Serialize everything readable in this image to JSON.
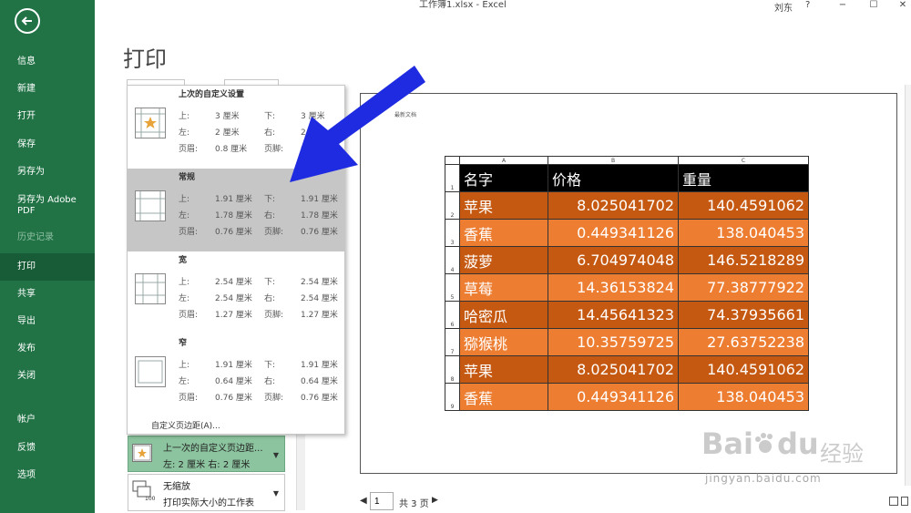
{
  "titlebar": {
    "title": "工作簿1.xlsx  -  Excel",
    "user": "刘东",
    "help": "?",
    "minimize": "−",
    "restore": "☐",
    "close": "✕"
  },
  "sidebar": {
    "items": [
      {
        "label": "信息",
        "state": "normal"
      },
      {
        "label": "新建",
        "state": "normal"
      },
      {
        "label": "打开",
        "state": "normal"
      },
      {
        "label": "保存",
        "state": "normal"
      },
      {
        "label": "另存为",
        "state": "normal"
      },
      {
        "label": "另存为 Adobe PDF",
        "state": "normal"
      },
      {
        "label": "历史记录",
        "state": "disabled"
      },
      {
        "label": "打印",
        "state": "active"
      },
      {
        "label": "共享",
        "state": "normal"
      },
      {
        "label": "导出",
        "state": "normal"
      },
      {
        "label": "发布",
        "state": "normal"
      },
      {
        "label": "关闭",
        "state": "normal"
      },
      {
        "label": "帐户",
        "state": "normal"
      },
      {
        "label": "反馈",
        "state": "normal"
      },
      {
        "label": "选项",
        "state": "normal"
      }
    ]
  },
  "page_title": "打印",
  "margins_dropdown": {
    "options": [
      {
        "name": "上次的自定义设置",
        "top_label": "上:",
        "top": "3 厘米",
        "bottom_label": "下:",
        "bottom": "3 厘米",
        "left_label": "左:",
        "left": "2 厘米",
        "right_label": "右:",
        "right": "2 厘米",
        "header_label": "页眉:",
        "header": "0.8 厘米",
        "footer_label": "页脚:",
        "footer": "0.8 厘米",
        "selected": false
      },
      {
        "name": "常规",
        "top_label": "上:",
        "top": "1.91 厘米",
        "bottom_label": "下:",
        "bottom": "1.91 厘米",
        "left_label": "左:",
        "left": "1.78 厘米",
        "right_label": "右:",
        "right": "1.78 厘米",
        "header_label": "页眉:",
        "header": "0.76 厘米",
        "footer_label": "页脚:",
        "footer": "0.76 厘米",
        "selected": true
      },
      {
        "name": "宽",
        "top_label": "上:",
        "top": "2.54 厘米",
        "bottom_label": "下:",
        "bottom": "2.54 厘米",
        "left_label": "左:",
        "left": "2.54 厘米",
        "right_label": "右:",
        "right": "2.54 厘米",
        "header_label": "页眉:",
        "header": "1.27 厘米",
        "footer_label": "页脚:",
        "footer": "1.27 厘米",
        "selected": false
      },
      {
        "name": "窄",
        "top_label": "上:",
        "top": "1.91 厘米",
        "bottom_label": "下:",
        "bottom": "1.91 厘米",
        "left_label": "左:",
        "left": "0.64 厘米",
        "right_label": "右:",
        "right": "0.64 厘米",
        "header_label": "页眉:",
        "header": "0.76 厘米",
        "footer_label": "页脚:",
        "footer": "0.76 厘米",
        "selected": false
      }
    ],
    "custom_label": "自定义页边距(A)..."
  },
  "margins_select": {
    "line1": "上一次的自定义页边距...",
    "line2": "左: 2 厘米    右: 2 厘米"
  },
  "scale_select": {
    "line1": "无缩放",
    "line2": "打印实际大小的工作表",
    "icon_text": "100"
  },
  "preview": {
    "header_text": "最新文档",
    "col_headers": [
      "A",
      "B",
      "C"
    ],
    "row_numbers": [
      "1",
      "2",
      "3",
      "4",
      "5",
      "6",
      "7",
      "8",
      "9"
    ],
    "header_row": [
      "名字",
      "价格",
      "重量"
    ],
    "rows": [
      [
        "苹果",
        "8.025041702",
        "140.4591062"
      ],
      [
        "香蕉",
        "0.449341126",
        "138.040453"
      ],
      [
        "菠萝",
        "6.704974048",
        "146.5218289"
      ],
      [
        "草莓",
        "14.36153824",
        "77.38777922"
      ],
      [
        "哈密瓜",
        "14.45641323",
        "74.37935661"
      ],
      [
        "猕猴桃",
        "10.35759725",
        "27.63752238"
      ],
      [
        "苹果",
        "8.025041702",
        "140.4591062"
      ],
      [
        "香蕉",
        "0.449341126",
        "138.040453"
      ]
    ]
  },
  "pager": {
    "prev": "◀",
    "current": "1",
    "total": "共 3 页",
    "next": "▶"
  },
  "watermark": {
    "logo": "Bai",
    "logo_end": "du",
    "cn": "经验",
    "url": "jingyan.baidu.com"
  },
  "colors": {
    "sidebar": "#217346",
    "active": "#185c37",
    "dark_row": "#c65911",
    "light_row": "#ed7d31",
    "arrow": "#1f2be0"
  }
}
